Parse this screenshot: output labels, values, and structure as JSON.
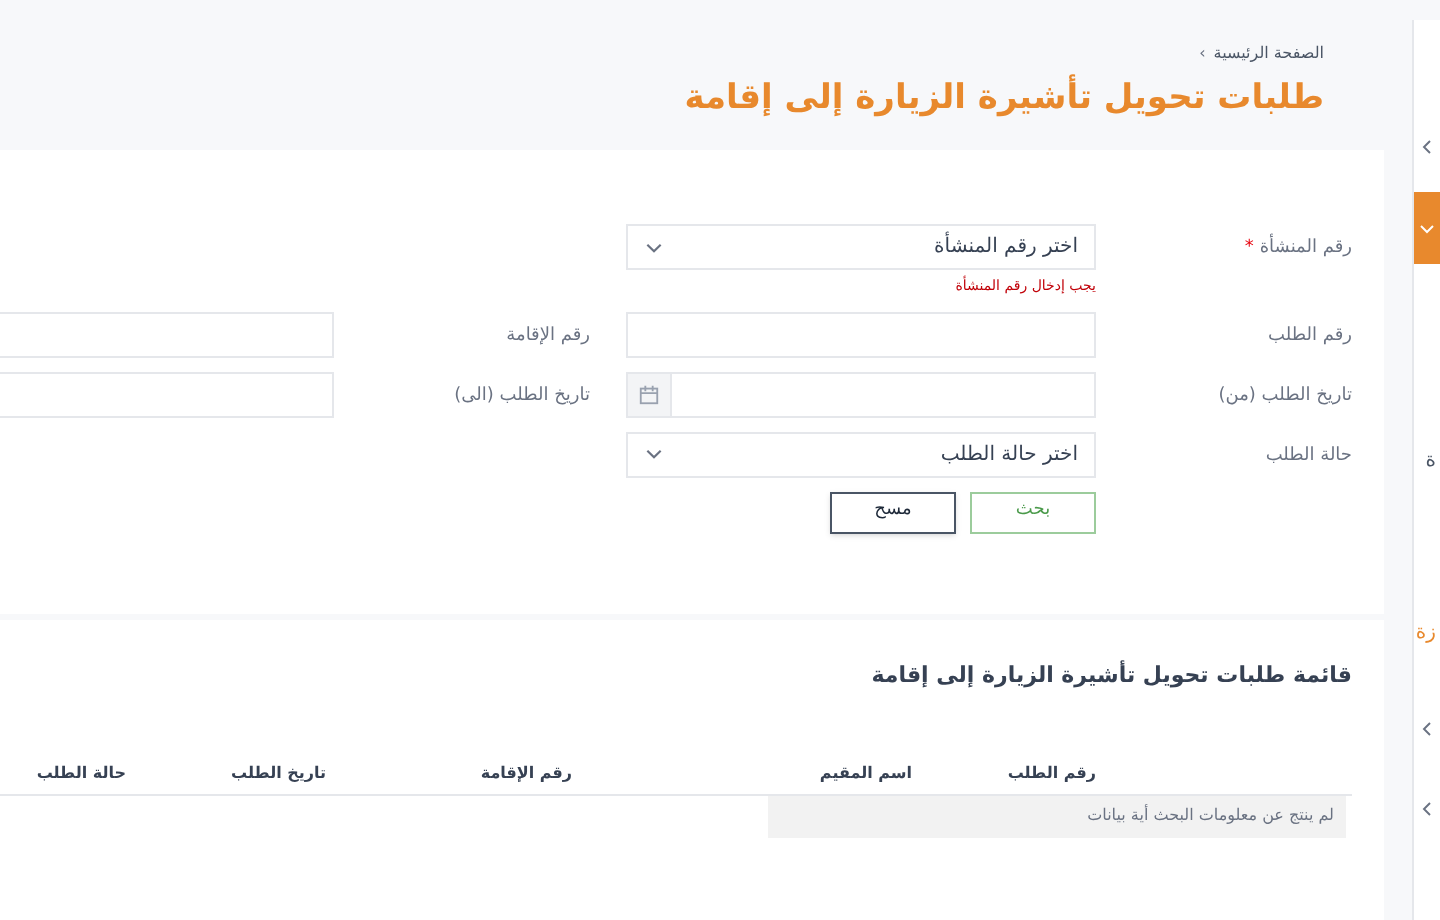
{
  "breadcrumb": {
    "text": "الصفحة الرئيسية",
    "separator": "›"
  },
  "title": "طلبات تحويل تأشيرة الزيارة إلى إقامة",
  "form": {
    "rows": [
      [
        {
          "label": "رقم المنشأة",
          "required_mark": "*",
          "kind": "select",
          "placeholder": "اختر رقم المنشأة",
          "error": "يجب إدخال رقم المنشأة"
        }
      ],
      [
        {
          "label": "رقم الطلب",
          "kind": "text"
        },
        {
          "label": "رقم الإقامة",
          "kind": "text"
        }
      ],
      [
        {
          "label": "تاريخ الطلب (من)",
          "kind": "date"
        },
        {
          "label": "تاريخ الطلب (الى)",
          "kind": "text"
        }
      ],
      [
        {
          "label": "حالة الطلب",
          "kind": "select",
          "placeholder": "اختر حالة الطلب"
        }
      ]
    ],
    "buttons": [
      {
        "label": "بحث",
        "kind": "primary"
      },
      {
        "label": "مسح",
        "kind": "secondary"
      }
    ]
  },
  "results": {
    "title": "قائمة طلبات تحويل تأشيرة الزيارة إلى إقامة",
    "columns": [
      "رقم الطلب",
      "اسم المقيم",
      "رقم الإقامة",
      "تاريخ الطلب",
      "حالة الطلب"
    ],
    "empty_message": "لم ينتج عن معلومات البحث أية بيانات"
  },
  "sidebar": {
    "items": [
      {
        "kind": "expander",
        "selected": false
      },
      {
        "kind": "expander",
        "selected": true
      },
      {
        "kind": "label",
        "label": "ة",
        "selected": false
      },
      {
        "kind": "label",
        "label": "زة",
        "selected": true
      },
      {
        "kind": "expander",
        "selected": false
      },
      {
        "kind": "expander",
        "selected": false
      }
    ]
  }
}
